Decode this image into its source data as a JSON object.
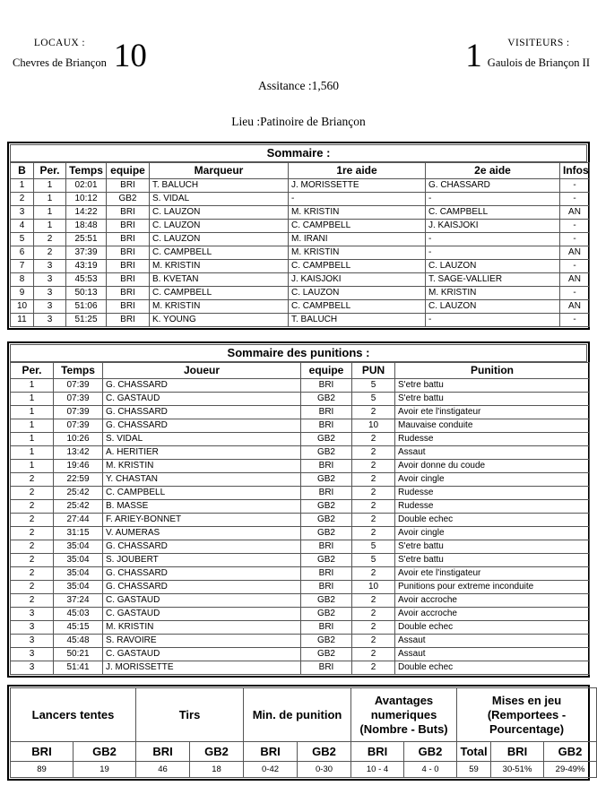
{
  "header": {
    "home_role": "LOCAUX :",
    "home_team": "Chevres de Briançon",
    "home_score": "10",
    "away_role": "VISITEURS :",
    "away_team": "Gaulois de Briançon II",
    "away_score": "1",
    "attendance": "Assitance :1,560",
    "venue": "Lieu :Patinoire de Briançon"
  },
  "summary": {
    "caption": "Sommaire :",
    "columns": [
      "B",
      "Per.",
      "Temps",
      "equipe",
      "Marqueur",
      "1re aide",
      "2e aide",
      "Infos"
    ],
    "rows": [
      [
        "1",
        "1",
        "02:01",
        "BRI",
        "T. BALUCH",
        "J. MORISSETTE",
        "G. CHASSARD",
        "-"
      ],
      [
        "2",
        "1",
        "10:12",
        "GB2",
        "S. VIDAL",
        "-",
        "-",
        "-"
      ],
      [
        "3",
        "1",
        "14:22",
        "BRI",
        "C. LAUZON",
        "M. KRISTIN",
        "C. CAMPBELL",
        "AN"
      ],
      [
        "4",
        "1",
        "18:48",
        "BRI",
        "C. LAUZON",
        "C. CAMPBELL",
        "J. KAISJOKI",
        "-"
      ],
      [
        "5",
        "2",
        "25:51",
        "BRI",
        "C. LAUZON",
        "M. IRANI",
        "-",
        "-"
      ],
      [
        "6",
        "2",
        "37:39",
        "BRI",
        "C. CAMPBELL",
        "M. KRISTIN",
        "-",
        "AN"
      ],
      [
        "7",
        "3",
        "43:19",
        "BRI",
        "M. KRISTIN",
        "C. CAMPBELL",
        "C. LAUZON",
        "-"
      ],
      [
        "8",
        "3",
        "45:53",
        "BRI",
        "B. KVETAN",
        "J. KAISJOKI",
        "T. SAGE-VALLIER",
        "AN"
      ],
      [
        "9",
        "3",
        "50:13",
        "BRI",
        "C. CAMPBELL",
        "C. LAUZON",
        "M. KRISTIN",
        "-"
      ],
      [
        "10",
        "3",
        "51:06",
        "BRI",
        "M. KRISTIN",
        "C. CAMPBELL",
        "C. LAUZON",
        "AN"
      ],
      [
        "11",
        "3",
        "51:25",
        "BRI",
        "K. YOUNG",
        "T. BALUCH",
        "-",
        "-"
      ]
    ]
  },
  "penalties": {
    "caption": "Sommaire des punitions :",
    "columns": [
      "Per.",
      "Temps",
      "Joueur",
      "equipe",
      "PUN",
      "Punition"
    ],
    "rows": [
      [
        "1",
        "07:39",
        "G. CHASSARD",
        "BRI",
        "5",
        "S'etre battu"
      ],
      [
        "1",
        "07:39",
        "C. GASTAUD",
        "GB2",
        "5",
        "S'etre battu"
      ],
      [
        "1",
        "07:39",
        "G. CHASSARD",
        "BRI",
        "2",
        "Avoir ete l'instigateur"
      ],
      [
        "1",
        "07:39",
        "G. CHASSARD",
        "BRI",
        "10",
        "Mauvaise conduite"
      ],
      [
        "1",
        "10:26",
        "S. VIDAL",
        "GB2",
        "2",
        "Rudesse"
      ],
      [
        "1",
        "13:42",
        "A. HERITIER",
        "GB2",
        "2",
        "Assaut"
      ],
      [
        "1",
        "19:46",
        "M. KRISTIN",
        "BRI",
        "2",
        "Avoir donne du coude"
      ],
      [
        "2",
        "22:59",
        "Y. CHASTAN",
        "GB2",
        "2",
        "Avoir cingle"
      ],
      [
        "2",
        "25:42",
        "C. CAMPBELL",
        "BRI",
        "2",
        "Rudesse"
      ],
      [
        "2",
        "25:42",
        "B. MASSE",
        "GB2",
        "2",
        "Rudesse"
      ],
      [
        "2",
        "27:44",
        "F. ARIEY-BONNET",
        "GB2",
        "2",
        "Double echec"
      ],
      [
        "2",
        "31:15",
        "V. AUMERAS",
        "GB2",
        "2",
        "Avoir cingle"
      ],
      [
        "2",
        "35:04",
        "G. CHASSARD",
        "BRI",
        "5",
        "S'etre battu"
      ],
      [
        "2",
        "35:04",
        "S. JOUBERT",
        "GB2",
        "5",
        "S'etre battu"
      ],
      [
        "2",
        "35:04",
        "G. CHASSARD",
        "BRI",
        "2",
        "Avoir ete l'instigateur"
      ],
      [
        "2",
        "35:04",
        "G. CHASSARD",
        "BRI",
        "10",
        "Punitions pour extreme inconduite"
      ],
      [
        "2",
        "37:24",
        "C. GASTAUD",
        "GB2",
        "2",
        "Avoir accroche"
      ],
      [
        "3",
        "45:03",
        "C. GASTAUD",
        "GB2",
        "2",
        "Avoir accroche"
      ],
      [
        "3",
        "45:15",
        "M. KRISTIN",
        "BRI",
        "2",
        "Double echec"
      ],
      [
        "3",
        "45:48",
        "S. RAVOIRE",
        "GB2",
        "2",
        "Assaut"
      ],
      [
        "3",
        "50:21",
        "C. GASTAUD",
        "GB2",
        "2",
        "Assaut"
      ],
      [
        "3",
        "51:41",
        "J. MORISSETTE",
        "BRI",
        "2",
        "Double echec"
      ]
    ]
  },
  "stats": {
    "groups": [
      "Lancers tentes",
      "Tirs",
      "Min. de punition",
      "Avantages numeriques (Nombre - Buts)",
      "Mises en jeu (Remportees - Pourcentage)"
    ],
    "subheaders": [
      "BRI",
      "GB2",
      "BRI",
      "GB2",
      "BRI",
      "GB2",
      "BRI",
      "GB2",
      "Total",
      "BRI",
      "GB2"
    ],
    "values": [
      "89",
      "19",
      "46",
      "18",
      "0-42",
      "0-30",
      "10 - 4",
      "4 - 0",
      "59",
      "30-51%",
      "29-49%"
    ]
  }
}
